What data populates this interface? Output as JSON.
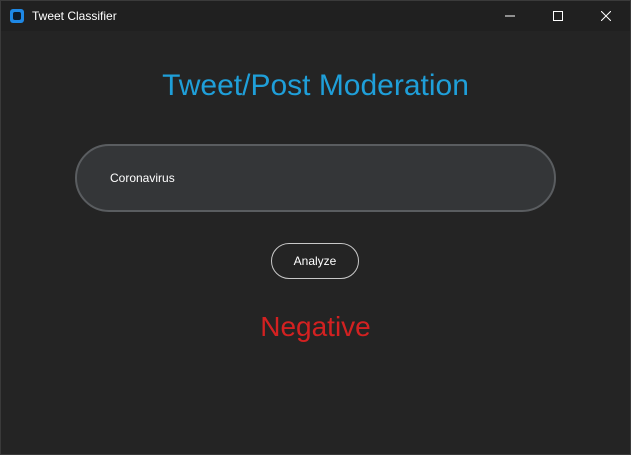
{
  "window": {
    "title": "Tweet Classifier",
    "icon": "app-icon",
    "controls": [
      "minimize-icon",
      "maximize-icon",
      "close-icon"
    ]
  },
  "main": {
    "heading": "Tweet/Post Moderation",
    "tweet_input": {
      "value": "Coronavirus",
      "placeholder": ""
    },
    "analyze_label": "Analyze",
    "result_text": "Negative"
  },
  "colors": {
    "heading": "#1f9fd9",
    "result_negative": "#d32121",
    "background": "#242424",
    "titlebar": "#202020"
  }
}
